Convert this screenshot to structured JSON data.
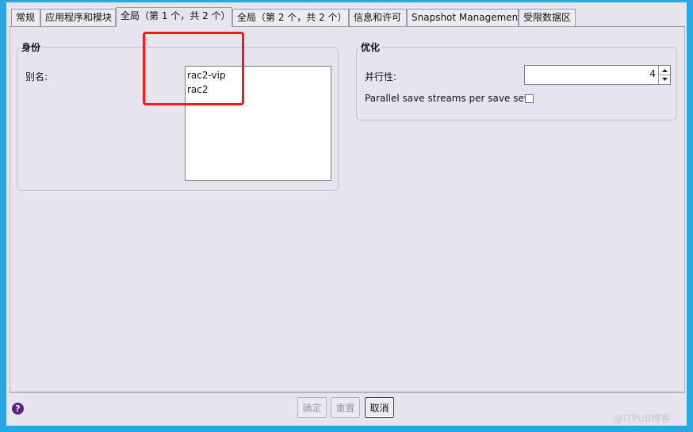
{
  "tabs": [
    {
      "label": "常规"
    },
    {
      "label": "应用程序和模块"
    },
    {
      "label": "全局（第 1 个，共 2 个）"
    },
    {
      "label": "全局（第 2 个，共 2 个）"
    },
    {
      "label": "信息和许可"
    },
    {
      "label": "Snapshot Management"
    },
    {
      "label": "受限数据区"
    }
  ],
  "active_tab": "全局（第 1 个，共 2 个）",
  "identity": {
    "title": "身份",
    "alias_label": "别名:",
    "aliases": [
      "rac2-vip",
      "rac2"
    ]
  },
  "optimization": {
    "title": "优化",
    "parallelism_label": "并行性:",
    "parallelism_value": "4",
    "parallel_streams_label": "Parallel save streams per save set:",
    "parallel_streams_checked": false
  },
  "footer": {
    "ok_label": "确定",
    "reset_label": "重置",
    "cancel_label": "取消",
    "help_icon": "?"
  },
  "watermark": "@ITPUB博客",
  "colors": {
    "frame": "#28a7e0",
    "highlight": "#ee1c1c",
    "help": "#5b1f86"
  }
}
